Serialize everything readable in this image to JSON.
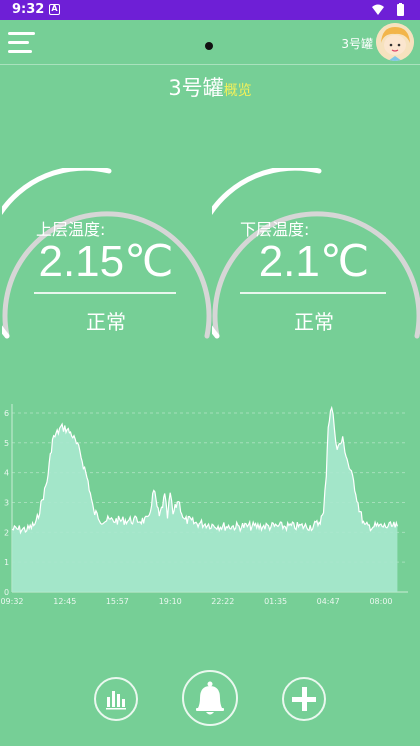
{
  "status_bar": {
    "time": "9:32",
    "notification_icon": "A"
  },
  "header": {
    "tank_label": "3号罐"
  },
  "title": {
    "main": "3号罐",
    "sub": "概览"
  },
  "gauges": [
    {
      "label": "上层温度:",
      "value": "2.15℃",
      "status": "正常"
    },
    {
      "label": "下层温度:",
      "value": "2.1℃",
      "status": "正常"
    }
  ],
  "chart_data": {
    "type": "area",
    "x_tick_labels": [
      "09:32",
      "12:45",
      "15:57",
      "19:10",
      "22:22",
      "01:35",
      "04:47",
      "08:00"
    ],
    "y_ticks": [
      0,
      1,
      2,
      3,
      4,
      5,
      6
    ],
    "ylim": [
      0,
      6.3
    ],
    "grid": "horizontal-dashed",
    "series": [
      {
        "color": "#ffffff",
        "x": [
          "09:32",
          "10:30",
          "11:00",
          "11:40",
          "12:00",
          "12:30",
          "12:45",
          "13:10",
          "13:40",
          "14:10",
          "14:30",
          "15:00",
          "15:57",
          "16:30",
          "17:20",
          "17:50",
          "18:10",
          "18:30",
          "18:50",
          "19:00",
          "19:10",
          "19:20",
          "19:40",
          "20:00",
          "20:20",
          "20:40",
          "21:00",
          "22:22",
          "23:30",
          "01:35",
          "02:50",
          "03:50",
          "04:10",
          "04:30",
          "04:40",
          "04:47",
          "05:00",
          "05:10",
          "05:20",
          "05:40",
          "06:00",
          "06:20",
          "06:40",
          "07:00",
          "08:00",
          "09:00"
        ],
        "values": [
          2.1,
          2.1,
          2.3,
          3.7,
          5.1,
          5.5,
          5.5,
          5.3,
          4.7,
          3.7,
          2.7,
          2.4,
          2.4,
          2.4,
          2.4,
          2.4,
          3.4,
          2.5,
          3.2,
          2.5,
          3.3,
          2.6,
          3.1,
          2.4,
          2.4,
          2.3,
          2.3,
          2.2,
          2.2,
          2.2,
          2.2,
          2.2,
          2.3,
          2.6,
          4.0,
          5.6,
          6.2,
          5.5,
          4.8,
          5.1,
          4.3,
          3.7,
          2.8,
          2.2,
          2.2,
          2.2
        ]
      }
    ]
  },
  "bottom_nav": [
    {
      "icon": "bar-chart-icon"
    },
    {
      "icon": "bell-icon"
    },
    {
      "icon": "plus-icon"
    }
  ],
  "colors": {
    "background": "#76CF96",
    "status_bar": "#6E1FD6",
    "subtitle": "#F2F05A",
    "chart_fill": "#A8E8CE"
  }
}
